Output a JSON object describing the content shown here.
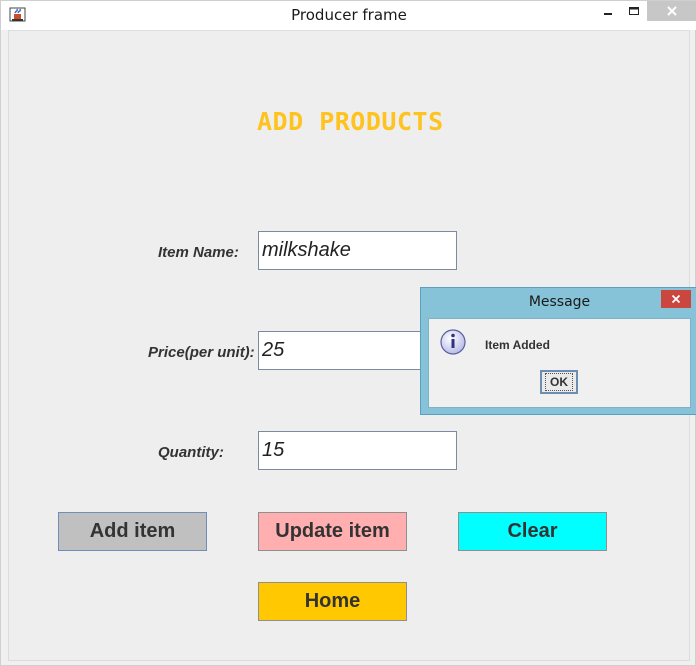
{
  "window": {
    "title": "Producer frame",
    "icon": "java-cup-icon"
  },
  "form": {
    "heading": "ADD PRODUCTS",
    "heading_color": "#fec31e",
    "item_name": {
      "label": "Item Name:",
      "value": "milkshake"
    },
    "price": {
      "label": "Price(per unit):",
      "value": "25"
    },
    "quantity": {
      "label": "Quantity:",
      "value": "15"
    }
  },
  "buttons": {
    "add": {
      "label": "Add item",
      "color": "#c0c0c0"
    },
    "update": {
      "label": "Update item",
      "color": "#ffafaf"
    },
    "clear": {
      "label": "Clear",
      "color": "#00ffff"
    },
    "home": {
      "label": "Home",
      "color": "#ffc800"
    }
  },
  "dialog": {
    "title": "Message",
    "message": "Item Added",
    "ok_label": "OK",
    "icon": "info-icon"
  }
}
